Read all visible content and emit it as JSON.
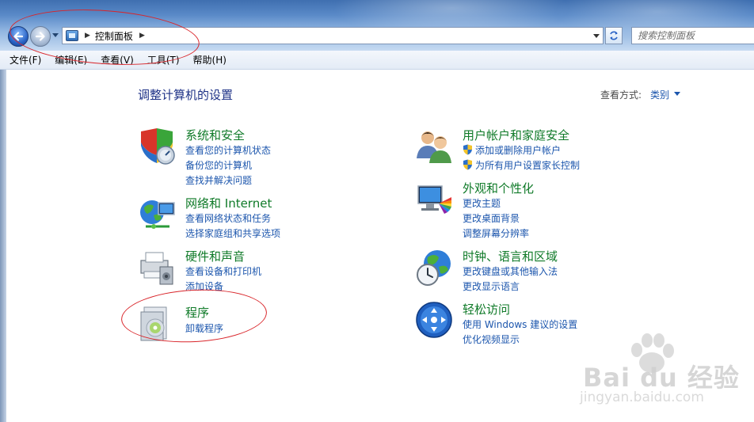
{
  "address_bar": {
    "breadcrumb": "控制面板",
    "search_placeholder": "搜索控制面板"
  },
  "menu": [
    "文件(F)",
    "编辑(E)",
    "查看(V)",
    "工具(T)",
    "帮助(H)"
  ],
  "page": {
    "title": "调整计算机的设置",
    "view_by_label": "查看方式:",
    "view_by_value": "类别"
  },
  "categories": [
    {
      "title": "系统和安全",
      "icon": "system-security-icon",
      "links": [
        "查看您的计算机状态",
        "备份您的计算机",
        "查找并解决问题"
      ]
    },
    {
      "title": "网络和 Internet",
      "icon": "network-icon",
      "links": [
        "查看网络状态和任务",
        "选择家庭组和共享选项"
      ]
    },
    {
      "title": "硬件和声音",
      "icon": "hardware-sound-icon",
      "links": [
        "查看设备和打印机",
        "添加设备"
      ]
    },
    {
      "title": "程序",
      "icon": "programs-icon",
      "links": [
        "卸载程序"
      ]
    },
    {
      "title": "用户帐户和家庭安全",
      "icon": "user-accounts-icon",
      "links": [
        "添加或删除用户帐户",
        "为所有用户设置家长控制"
      ]
    },
    {
      "title": "外观和个性化",
      "icon": "appearance-icon",
      "links": [
        "更改主题",
        "更改桌面背景",
        "调整屏幕分辨率"
      ]
    },
    {
      "title": "时钟、语言和区域",
      "icon": "clock-language-icon",
      "links": [
        "更改键盘或其他输入法",
        "更改显示语言"
      ]
    },
    {
      "title": "轻松访问",
      "icon": "ease-of-access-icon",
      "links": [
        "使用 Windows 建议的设置",
        "优化视频显示"
      ]
    }
  ],
  "watermark": {
    "brand": "Bai  du 经验",
    "url": "jingyan.baidu.com"
  },
  "colors": {
    "category_title": "#0f7a28",
    "link": "#1c56ad",
    "page_title": "#1e3287",
    "annotation": "#d9252a"
  }
}
